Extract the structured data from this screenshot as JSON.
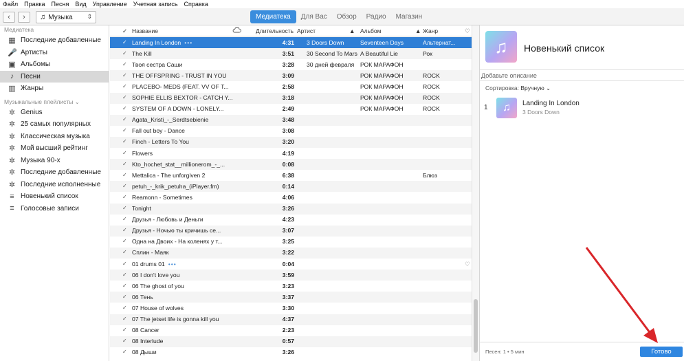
{
  "menu": [
    "Файл",
    "Правка",
    "Песня",
    "Вид",
    "Управление",
    "Учетная запись",
    "Справка"
  ],
  "toolbar": {
    "back_icon": "chevron-left-icon",
    "forward_icon": "chevron-right-icon",
    "media_icon": "music-note-icon",
    "media_label": "Музыка",
    "tabs": [
      "Медиатека",
      "Для Вас",
      "Обзор",
      "Радио",
      "Магазин"
    ],
    "active_tab": "Медиатека"
  },
  "sidebar": {
    "library_header": "Медиатека",
    "library_items": [
      {
        "label": "Последние добавленные",
        "icon": "grid-icon"
      },
      {
        "label": "Артисты",
        "icon": "microphone-icon"
      },
      {
        "label": "Альбомы",
        "icon": "album-icon"
      },
      {
        "label": "Песни",
        "icon": "music-note-icon",
        "selected": true
      },
      {
        "label": "Жанры",
        "icon": "genre-icon"
      }
    ],
    "playlists_header": "Музыкальные плейлисты ⌄",
    "playlist_items": [
      {
        "label": "Genius",
        "icon": "gear-icon"
      },
      {
        "label": "25 самых популярных",
        "icon": "gear-icon"
      },
      {
        "label": "Классическая музыка",
        "icon": "gear-icon"
      },
      {
        "label": "Мой высший рейтинг",
        "icon": "gear-icon"
      },
      {
        "label": "Музыка 90-х",
        "icon": "gear-icon"
      },
      {
        "label": "Последние добавленные",
        "icon": "gear-icon"
      },
      {
        "label": "Последние исполненные",
        "icon": "gear-icon"
      },
      {
        "label": "Новенький список",
        "icon": "playlist-icon"
      },
      {
        "label": "Голосовые записи",
        "icon": "playlist-icon"
      }
    ]
  },
  "table": {
    "columns": {
      "check": "✓",
      "name": "Название",
      "cloud": "cloud-icon",
      "duration": "Длительность",
      "artist": "Артист",
      "album": "Альбом",
      "genre": "Жанр",
      "love": "heart-icon"
    },
    "rows": [
      {
        "name": "Landing In London",
        "dots": "•••",
        "duration": "4:31",
        "artist": "3 Doors Down",
        "album": "Seventeen Days",
        "genre": "Альтернат...",
        "selected": true
      },
      {
        "name": "The Kill",
        "duration": "3:51",
        "artist": "30 Second To Mars",
        "album": "A Beautiful Lie",
        "genre": "Рок"
      },
      {
        "name": "Твоя сестра Саши",
        "duration": "3:28",
        "artist": "30 дней февраля",
        "album": "РОК МАРАФОН",
        "genre": ""
      },
      {
        "name": "THE OFFSPRING - TRUST IN YOU",
        "duration": "3:09",
        "artist": "",
        "album": "РОК МАРАФОН",
        "genre": "ROCK"
      },
      {
        "name": "PLACEBO- MEDS (FEAT. VV OF T...",
        "duration": "2:58",
        "artist": "",
        "album": "РОК МАРАФОН",
        "genre": "ROCK"
      },
      {
        "name": "SOPHIE ELLIS BEXTOR - CATCH Y...",
        "duration": "3:18",
        "artist": "",
        "album": "РОК МАРАФОН",
        "genre": "ROCK"
      },
      {
        "name": "SYSTEM OF A DOWN - LONELY...",
        "duration": "2:49",
        "artist": "",
        "album": "РОК МАРАФОН",
        "genre": "ROCK"
      },
      {
        "name": "Agata_Kristi_-_Serdtsebienie",
        "duration": "3:48"
      },
      {
        "name": "Fall out boy - Dance",
        "duration": "3:08"
      },
      {
        "name": "Finch - Letters To You",
        "duration": "3:20"
      },
      {
        "name": "Flowers",
        "duration": "4:19"
      },
      {
        "name": "Kto_hochet_stat__millionerom_-_...",
        "duration": "0:08"
      },
      {
        "name": "Mettalica - The unforgiven 2",
        "duration": "6:38",
        "genre": "Блюз"
      },
      {
        "name": "petuh_-_krik_petuha_(iPlayer.fm)",
        "duration": "0:14"
      },
      {
        "name": "Reamonn - Sometimes",
        "duration": "4:06"
      },
      {
        "name": "Tonight",
        "duration": "3:26"
      },
      {
        "name": "Друзья - Любовь и Деньги",
        "duration": "4:23"
      },
      {
        "name": "Друзья - Ночью ты кричишь се...",
        "duration": "3:07"
      },
      {
        "name": "Одна на Двоих - На коленях у т...",
        "duration": "3:25"
      },
      {
        "name": "Сплин - Маяк",
        "duration": "3:22"
      },
      {
        "name": "01 drums 01",
        "dots": "•••",
        "duration": "0:04",
        "love": "heart-icon"
      },
      {
        "name": "06 I don't love you",
        "duration": "3:59"
      },
      {
        "name": "06 The ghost of you",
        "duration": "3:23"
      },
      {
        "name": "06 Тень",
        "duration": "3:37"
      },
      {
        "name": "07 House of wolves",
        "duration": "3:30"
      },
      {
        "name": "07 The jetset life is gonna kill you",
        "duration": "4:37"
      },
      {
        "name": "08 Cancer",
        "duration": "2:23"
      },
      {
        "name": "08 Interlude",
        "duration": "0:57"
      },
      {
        "name": "08 Дыши",
        "duration": "3:26"
      }
    ]
  },
  "panel": {
    "artwork_icon": "music-note-icon",
    "title": "Новенький список",
    "description_placeholder": "Добавьте описание",
    "sort_label": "Сортировка:",
    "sort_value": "Вручную ⌄",
    "tracks": [
      {
        "num": "1",
        "title": "Landing In London",
        "artist": "3 Doors Down"
      }
    ],
    "footer_count": "Песен: 1 • 5 мин",
    "done_label": "Готово"
  },
  "colors": {
    "accent": "#2f7fd6",
    "annotation_arrow": "#d9262a"
  }
}
